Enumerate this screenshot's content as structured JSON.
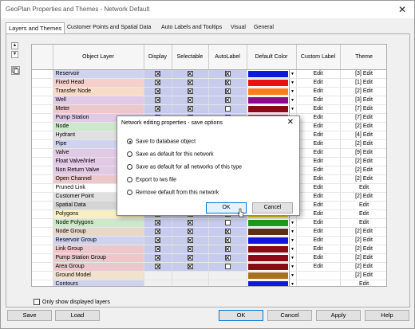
{
  "window": {
    "title": "GeoPlan Properties and Themes - Network Default",
    "close_glyph": "✕"
  },
  "tabs": [
    "Layers and Themes",
    "Customer Points and Spatial Data",
    "Auto Labels and Tooltips",
    "Visual",
    "General"
  ],
  "grid": {
    "headers": [
      "",
      "Object Layer",
      "Display",
      "Selectable",
      "AutoLabel",
      "Default Color",
      "Custom Label",
      "Theme"
    ],
    "rows": [
      {
        "name": "Reservoir",
        "bg": "#cfd3f0",
        "display": true,
        "selectable": true,
        "autolabel": true,
        "color": "#1018e0",
        "custom_label": "Edit",
        "theme": "[3] Edit"
      },
      {
        "name": "Fixed Head",
        "bg": "#f6cfca",
        "display": true,
        "selectable": true,
        "autolabel": true,
        "color": "#ee1010",
        "custom_label": "Edit",
        "theme": "[1] Edit"
      },
      {
        "name": "Transfer Node",
        "bg": "#f9dcc8",
        "display": true,
        "selectable": true,
        "autolabel": true,
        "color": "#ff7c1a",
        "custom_label": "Edit",
        "theme": "[2] Edit"
      },
      {
        "name": "Well",
        "bg": "#e2c9e6",
        "display": true,
        "selectable": true,
        "autolabel": true,
        "color": "#8a0c8a",
        "custom_label": "Edit",
        "theme": "[3] Edit"
      },
      {
        "name": "Meter",
        "bg": "#ecc8cb",
        "display": true,
        "selectable": true,
        "autolabel": false,
        "color": "#8a0a16",
        "custom_label": "Edit",
        "theme": "[7] Edit"
      },
      {
        "name": "Pump Station",
        "bg": "#e2c9e6",
        "display": true,
        "selectable": true,
        "autolabel": false,
        "color": "#8a0c8a",
        "custom_label": "Edit",
        "theme": "[7] Edit"
      },
      {
        "name": "Node",
        "bg": "#cde8cc",
        "display": true,
        "selectable": true,
        "autolabel": false,
        "color": "#1c9a1c",
        "custom_label": "Edit",
        "theme": "[2] Edit"
      },
      {
        "name": "Hydrant",
        "bg": "#e0e0e0",
        "display": true,
        "selectable": true,
        "autolabel": false,
        "color": "#606060",
        "custom_label": "Edit",
        "theme": "[4] Edit"
      },
      {
        "name": "Pipe",
        "bg": "#cfd3f0",
        "display": true,
        "selectable": true,
        "autolabel": false,
        "color": "#1018e0",
        "custom_label": "Edit",
        "theme": "[2] Edit"
      },
      {
        "name": "Valve",
        "bg": "#e2c9e6",
        "display": true,
        "selectable": true,
        "autolabel": false,
        "color": "#8a0c8a",
        "custom_label": "Edit",
        "theme": "[9] Edit"
      },
      {
        "name": "Float Valve/Inlet",
        "bg": "#e2c9e6",
        "display": true,
        "selectable": true,
        "autolabel": false,
        "color": "#8a0c8a",
        "custom_label": "Edit",
        "theme": "[2] Edit"
      },
      {
        "name": "Non Return Valve",
        "bg": "#e2c9e6",
        "display": true,
        "selectable": true,
        "autolabel": false,
        "color": "#8a0c8a",
        "custom_label": "Edit",
        "theme": "[2] Edit"
      },
      {
        "name": "Open Channel",
        "bg": "#ecc8cb",
        "display": true,
        "selectable": true,
        "autolabel": false,
        "color": "#8a0a16",
        "custom_label": "Edit",
        "theme": "[2] Edit"
      },
      {
        "name": "Pruned Link",
        "bg": "#ffffff",
        "display": true,
        "selectable": true,
        "autolabel": false,
        "color": "#ffffff",
        "custom_label": "Edit",
        "theme": "Edit"
      },
      {
        "name": "Customer Point",
        "bg": "#e0e0e0",
        "display": true,
        "selectable": true,
        "autolabel": false,
        "color": "#606060",
        "custom_label": "Edit",
        "theme": "[2] Edit"
      },
      {
        "name": "Spatial Data",
        "bg": "#d4d4d4",
        "display": true,
        "selectable": true,
        "autolabel": false,
        "color": "#505050",
        "custom_label": "Edit",
        "theme": "Edit"
      },
      {
        "name": "Polygons",
        "bg": "#f8f0c0",
        "display": true,
        "selectable": true,
        "autolabel": false,
        "color": "#f0d020",
        "custom_label": "Edit",
        "theme": "Edit"
      },
      {
        "name": "Node Polygons",
        "bg": "#cde8cc",
        "display": true,
        "selectable": true,
        "autolabel": false,
        "color": "#1c9a1c",
        "custom_label": "Edit",
        "theme": "Edit"
      },
      {
        "name": "Node Group",
        "bg": "#e8d8c8",
        "display": true,
        "selectable": true,
        "autolabel": true,
        "color": "#5c3010",
        "custom_label": "Edit",
        "theme": "[2] Edit"
      },
      {
        "name": "Reservoir Group",
        "bg": "#cfd3f0",
        "display": true,
        "selectable": true,
        "autolabel": true,
        "color": "#1018e0",
        "custom_label": "Edit",
        "theme": "[2] Edit"
      },
      {
        "name": "Link Group",
        "bg": "#ecc8cb",
        "display": true,
        "selectable": true,
        "autolabel": true,
        "color": "#8a0a16",
        "custom_label": "Edit",
        "theme": "[2] Edit"
      },
      {
        "name": "Pump Station Group",
        "bg": "#ecc8cb",
        "display": true,
        "selectable": true,
        "autolabel": true,
        "color": "#8a0a16",
        "custom_label": "Edit",
        "theme": "[2] Edit"
      },
      {
        "name": "Area Group",
        "bg": "#ecc8cb",
        "display": true,
        "selectable": true,
        "autolabel": false,
        "color": "#8a0a16",
        "custom_label": "Edit",
        "theme": "[2] Edit"
      },
      {
        "name": "Ground Model",
        "bg": "#f0e2cc",
        "display": null,
        "selectable": null,
        "autolabel": null,
        "color": "#a87020",
        "custom_label": "",
        "theme": "[2] Edit"
      },
      {
        "name": "Contours",
        "bg": "#cfd3f0",
        "display": null,
        "selectable": null,
        "autolabel": null,
        "color": "#1018e0",
        "custom_label": "",
        "theme": "Edit"
      }
    ]
  },
  "show_displayed_label": "Only show displayed layers",
  "buttons": {
    "save": "Save",
    "load": "Load",
    "ok": "OK",
    "cancel": "Cancel",
    "apply": "Apply",
    "help": "Help"
  },
  "dialog": {
    "title": "Network editing properties - save options",
    "options": [
      "Save to database object",
      "Save as default for this network",
      "Save as default for all networks of this type",
      "Export to iws file",
      "Remove default from this network"
    ],
    "selected_index": 0,
    "ok": "OK",
    "cancel": "Cancel"
  },
  "side_buttons": {
    "up": "▲",
    "down": "▼",
    "dropdown_arrow": "▼"
  }
}
